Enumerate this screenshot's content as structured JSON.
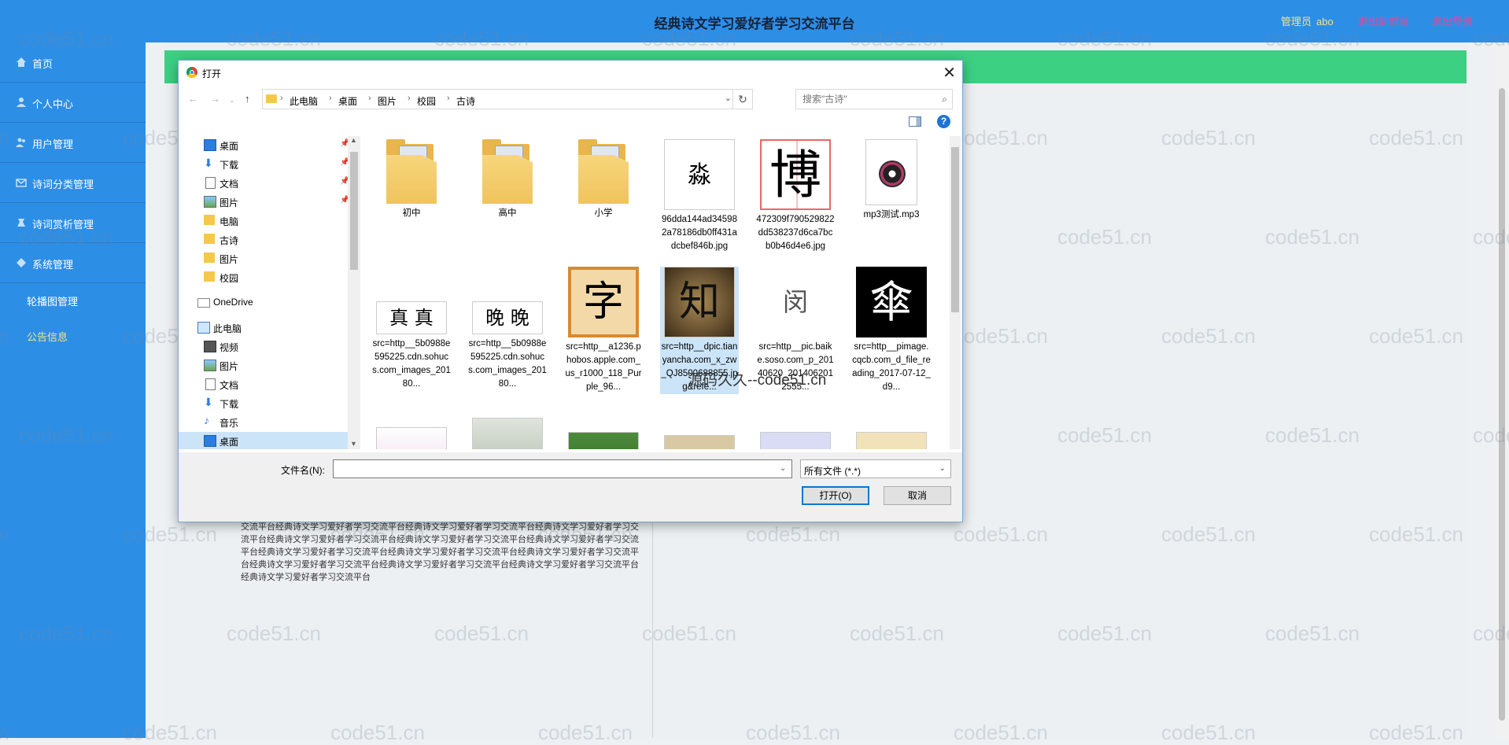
{
  "header": {
    "title": "经典诗文学习爱好者学习交流平台",
    "admin_label": "管理员",
    "admin_name": "abo",
    "back_to_frontend": "退出到前台",
    "logout": "退出登录"
  },
  "sidebar": {
    "items": [
      {
        "label": "首页",
        "icon": "home-icon"
      },
      {
        "label": "个人中心",
        "icon": "user-icon"
      },
      {
        "label": "用户管理",
        "icon": "users-icon"
      },
      {
        "label": "诗词分类管理",
        "icon": "category-icon"
      },
      {
        "label": "诗词赏析管理",
        "icon": "appreciation-icon"
      },
      {
        "label": "系统管理",
        "icon": "system-icon"
      }
    ],
    "subitems": [
      {
        "label": "轮播图管理"
      },
      {
        "label": "公告信息"
      }
    ]
  },
  "content": {
    "text": "交流平台经典诗文学习爱好者学习交流平台经典诗文学习爱好者学习交流平台经典诗文学习爱好者学习交流平台经典诗文学习爱好者学习交流平台经典诗文学习爱好者学习交流平台经典诗文学习爱好者学习交流平台经典诗文学习爱好者学习交流平台经典诗文学习爱好者学习交流平台经典诗文学习爱好者学习交流平台经典诗文学习爱好者学习交流平台经典诗文学习爱好者学习交流平台经典诗文学习爱好者学习交流平台经典诗文学习爱好者学习交流平台"
  },
  "watermark": {
    "text": "code51.cn",
    "overlay": "源码久久--code51.cn"
  },
  "dialog": {
    "title": "打开",
    "breadcrumb": [
      "此电脑",
      "桌面",
      "图片",
      "校园",
      "古诗"
    ],
    "search_placeholder": "搜索\"古诗\"",
    "tree": [
      {
        "label": "桌面",
        "icon": "desktop-icon",
        "pinned": true
      },
      {
        "label": "下载",
        "icon": "download-icon",
        "pinned": true
      },
      {
        "label": "文档",
        "icon": "document-icon",
        "pinned": true
      },
      {
        "label": "图片",
        "icon": "pictures-icon",
        "pinned": true
      },
      {
        "label": "电脑",
        "icon": "folder-icon"
      },
      {
        "label": "古诗",
        "icon": "folder-icon"
      },
      {
        "label": "图片",
        "icon": "folder-icon"
      },
      {
        "label": "校园",
        "icon": "folder-icon"
      },
      {
        "label": "OneDrive",
        "icon": "onedrive-icon"
      },
      {
        "label": "此电脑",
        "icon": "computer-icon"
      },
      {
        "label": "视频",
        "icon": "video-icon"
      },
      {
        "label": "图片",
        "icon": "pictures-icon"
      },
      {
        "label": "文档",
        "icon": "document-icon"
      },
      {
        "label": "下载",
        "icon": "download-icon"
      },
      {
        "label": "音乐",
        "icon": "music-icon"
      },
      {
        "label": "桌面",
        "icon": "desktop-icon",
        "selected": true
      }
    ],
    "files": [
      {
        "name": "初中",
        "type": "folder"
      },
      {
        "name": "高中",
        "type": "folder"
      },
      {
        "name": "小学",
        "type": "folder"
      },
      {
        "name": "96dda144ad345982a78186db0ff431adcbef846b.jpg",
        "type": "image",
        "glyph": "淼"
      },
      {
        "name": "472309f790529822dd538237d6ca7bcb0b46d4e6.jpg",
        "type": "image",
        "glyph": "博"
      },
      {
        "name": "mp3测试.mp3",
        "type": "audio"
      },
      {
        "name": "src=http__5b0988e595225.cdn.sohucs.com_images_20180...",
        "type": "image",
        "glyph": "真 真"
      },
      {
        "name": "src=http__5b0988e595225.cdn.sohucs.com_images_20180...",
        "type": "image",
        "glyph": "晚 晚"
      },
      {
        "name": "src=http__a1236.phobos.apple.com_us_r1000_118_Purple_96...",
        "type": "image",
        "glyph": "字"
      },
      {
        "name": "src=http__dpic.tianyancha.com_x_zw_QJ8500688855.jpg&refe...",
        "type": "image",
        "glyph": "知",
        "selected": true
      },
      {
        "name": "src=http__pic.baike.soso.com_p_20140620_2014062012555...",
        "type": "image",
        "glyph": "闵"
      },
      {
        "name": "src=http__pimage.cqcb.com_d_file_reading_2017-07-12_d9...",
        "type": "image",
        "glyph": "傘"
      }
    ],
    "filename_label": "文件名(N):",
    "filename_value": "",
    "filetype_value": "所有文件 (*.*)",
    "open_button": "打开(O)",
    "cancel_button": "取消"
  }
}
